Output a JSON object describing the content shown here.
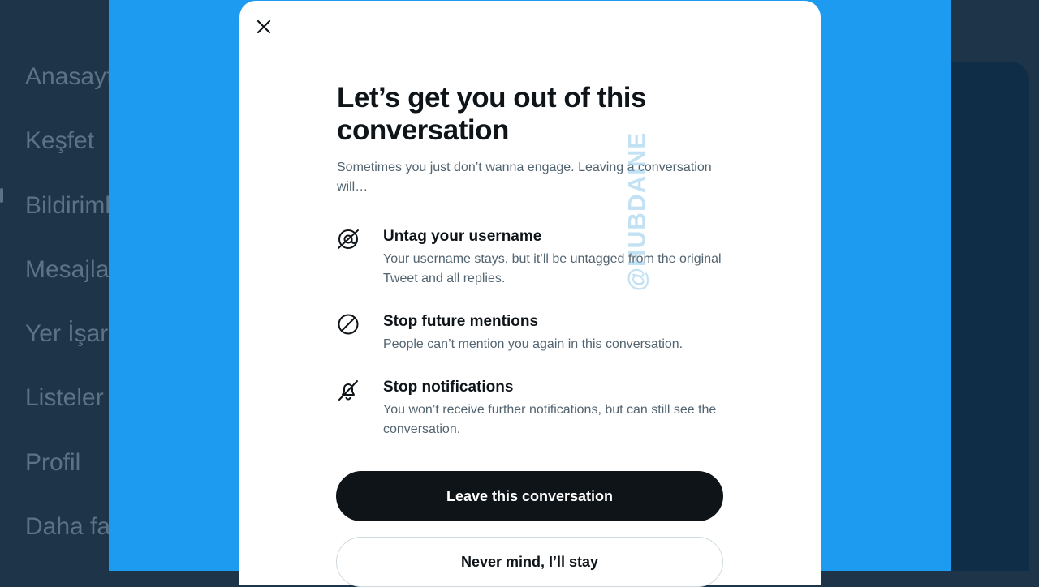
{
  "sidebar": {
    "items": [
      {
        "label": "Anasayfa"
      },
      {
        "label": "Keşfet"
      },
      {
        "label": "Bildirimler"
      },
      {
        "label": "Mesajlar"
      },
      {
        "label": "Yer İşaretleri"
      },
      {
        "label": "Listeler"
      },
      {
        "label": "Profil"
      },
      {
        "label": "Daha fazla"
      }
    ]
  },
  "modal": {
    "close_icon": "close-icon",
    "title": "Let’s get you out of this conversation",
    "subtitle": "Sometimes you just don’t wanna engage. Leaving a conversation will…",
    "features": [
      {
        "icon": "untag-icon",
        "title": "Untag your username",
        "description": "Your username stays, but it’ll be untagged from the original Tweet and all replies."
      },
      {
        "icon": "block-icon",
        "title": "Stop future mentions",
        "description": "People can’t mention you again in this conversation."
      },
      {
        "icon": "bell-off-icon",
        "title": "Stop notifications",
        "description": "You won’t receive further notifications, but can still see the conversation."
      }
    ],
    "primary_button": "Leave this conversation",
    "secondary_button": "Never mind, I’ll stay"
  },
  "watermark": "@HUBDAINE",
  "colors": {
    "backdrop": "#1d9bf0",
    "page_dim": "#1e3448",
    "primary_button": "#0f1419",
    "secondary_text": "#536471"
  }
}
